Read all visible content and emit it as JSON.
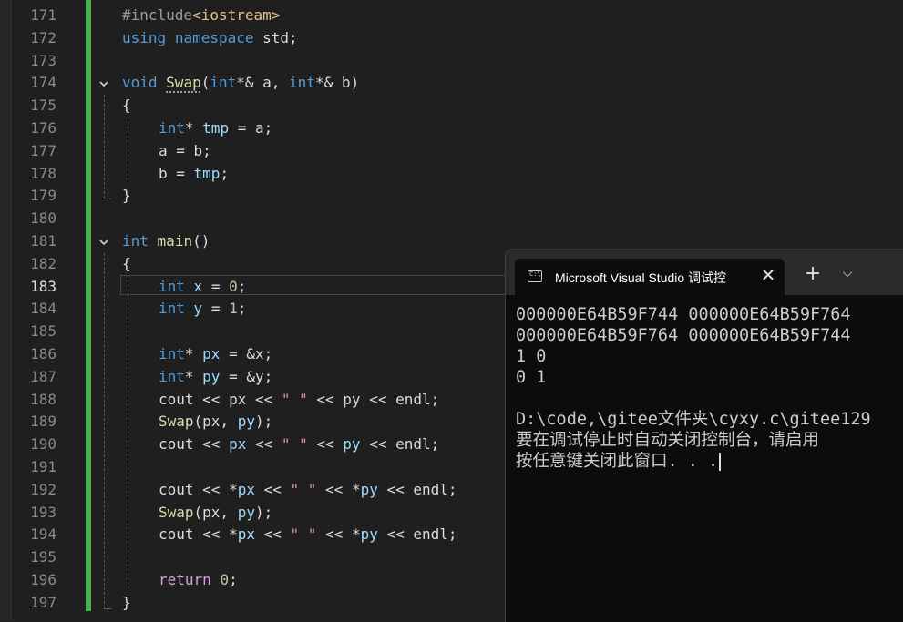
{
  "editor": {
    "active_line": "183",
    "line_numbers": [
      "171",
      "172",
      "173",
      "174",
      "175",
      "176",
      "177",
      "178",
      "179",
      "180",
      "181",
      "182",
      "183",
      "184",
      "185",
      "186",
      "187",
      "188",
      "189",
      "190",
      "191",
      "192",
      "193",
      "194",
      "195",
      "196",
      "197"
    ]
  },
  "code": {
    "l171": {
      "pp": "#include",
      "inc": "<iostream>"
    },
    "l172": {
      "kw1": "using",
      "kw2": "namespace",
      "rest": " std;"
    },
    "l174": {
      "kw": "void",
      "fn": "Swap",
      "p1": "(",
      "t1": "int",
      "p2": "*& a, ",
      "t2": "int",
      "p3": "*& b)"
    },
    "l175": {
      "text": "{"
    },
    "l176": {
      "t": "int",
      "p1": "* ",
      "v": "tmp",
      "p2": " = a;"
    },
    "l177": {
      "text": "a = b;"
    },
    "l178": {
      "p1": "b = ",
      "v": "tmp",
      "p2": ";"
    },
    "l179": {
      "text": "}"
    },
    "l181": {
      "kw": "int",
      "sp": " ",
      "fn": "main",
      "p": "()"
    },
    "l182": {
      "text": "{"
    },
    "l183": {
      "t": "int",
      "p1": " ",
      "v": "x",
      "p2": " = ",
      "n": "0",
      "p3": ";"
    },
    "l184": {
      "t": "int",
      "p1": " ",
      "v": "y",
      "p2": " = ",
      "n": "1",
      "p3": ";"
    },
    "l186": {
      "t": "int",
      "p1": "* ",
      "v": "px",
      "p2": " = &x;"
    },
    "l187": {
      "t": "int",
      "p1": "* ",
      "v": "py",
      "p2": " = &y;"
    },
    "l188": {
      "a": "cout << px << ",
      "s": "\" \"",
      "b": " << py << endl;"
    },
    "l189": {
      "fn": "Swap",
      "p1": "(px, ",
      "v": "py",
      "p2": ");"
    },
    "l190": {
      "a": "cout << ",
      "v1": "px",
      "b": " << ",
      "s": "\" \"",
      "c": " << ",
      "v2": "py",
      "d": " << endl;"
    },
    "l192": {
      "a": "cout << *",
      "v1": "px",
      "b": " << ",
      "s": "\" \"",
      "c": " << *",
      "v2": "py",
      "d": " << endl;"
    },
    "l193": {
      "fn": "Swap",
      "p1": "(px, ",
      "v": "py",
      "p2": ");"
    },
    "l194": {
      "a": "cout << *",
      "v1": "px",
      "b": " << ",
      "s": "\" \"",
      "c": " << *",
      "v2": "py",
      "d": " << endl;"
    },
    "l196": {
      "kw": "return",
      "p1": " ",
      "n": "0",
      "p2": ";"
    },
    "l197": {
      "text": "}"
    }
  },
  "console": {
    "tab_title": "Microsoft Visual Studio 调试控",
    "close_glyph": "✕",
    "add_glyph": "+",
    "dropdown_glyph": "⌵",
    "lines": [
      "000000E64B59F744 000000E64B59F764",
      "000000E64B59F764 000000E64B59F744",
      "1 0",
      "0 1",
      "",
      "D:\\code,\\gitee文件夹\\cyxy.c\\gitee129",
      "要在调试停止时自动关闭控制台，请启用",
      "按任意键关闭此窗口. . ."
    ]
  },
  "colors": {
    "background": "#1f1f1f",
    "keyword": "#569cd6",
    "function": "#dcdcaa",
    "variable": "#9cdcfe",
    "number": "#b5cea8",
    "string": "#d69d85",
    "change_bar": "#4caf50",
    "console_bg": "#0c0c0c"
  },
  "icons": {
    "fold": "chevron-down-icon",
    "terminal": "terminal-icon",
    "close": "close-icon",
    "add": "plus-icon",
    "dropdown": "chevron-down-icon"
  }
}
